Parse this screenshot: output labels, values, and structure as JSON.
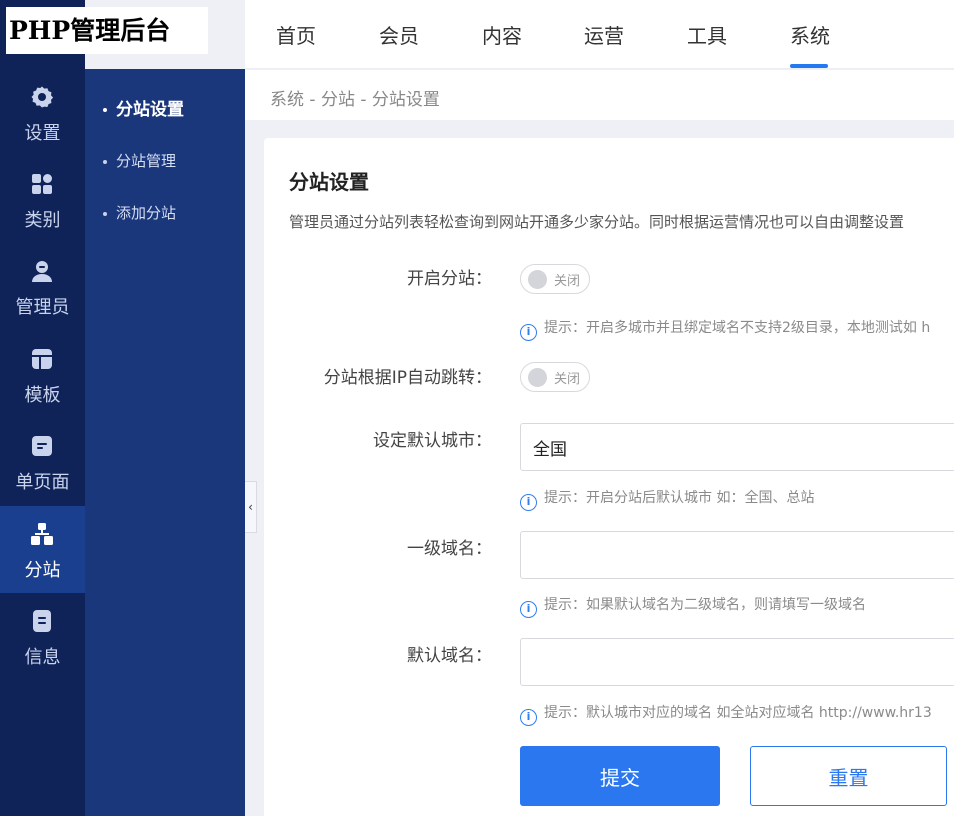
{
  "app": {
    "logo_text": "PHP管理后台"
  },
  "rail": {
    "items": [
      {
        "label": "设置",
        "icon": "gear-icon"
      },
      {
        "label": "类别",
        "icon": "grid-icon"
      },
      {
        "label": "管理员",
        "icon": "user-icon"
      },
      {
        "label": "模板",
        "icon": "template-icon"
      },
      {
        "label": "单页面",
        "icon": "page-icon"
      },
      {
        "label": "分站",
        "icon": "sitemap-icon",
        "active": true
      },
      {
        "label": "信息",
        "icon": "document-icon"
      }
    ]
  },
  "subnav": {
    "items": [
      {
        "label": "分站设置",
        "active": true
      },
      {
        "label": "分站管理"
      },
      {
        "label": "添加分站"
      }
    ]
  },
  "topnav": {
    "tabs": [
      {
        "label": "首页"
      },
      {
        "label": "会员"
      },
      {
        "label": "内容"
      },
      {
        "label": "运营"
      },
      {
        "label": "工具"
      },
      {
        "label": "系统",
        "active": true
      }
    ]
  },
  "breadcrumb": "系统 - 分站 - 分站设置",
  "card": {
    "title": "分站设置",
    "description": "管理员通过分站列表轻松查询到网站开通多少家分站。同时根据运营情况也可以自由调整设置"
  },
  "form": {
    "enable_substation": {
      "label": "开启分站：",
      "toggle_text": "关闭",
      "hint": "提示：开启多城市并且绑定域名不支持2级目录，本地测试如 h"
    },
    "ip_redirect": {
      "label": "分站根据IP自动跳转：",
      "toggle_text": "关闭"
    },
    "default_city": {
      "label": "设定默认城市：",
      "value": "全国",
      "hint": "提示：开启分站后默认城市 如：全国、总站"
    },
    "top_domain": {
      "label": "一级域名：",
      "value": "",
      "hint": "提示：如果默认域名为二级域名，则请填写一级域名"
    },
    "default_domain": {
      "label": "默认域名：",
      "value": "",
      "hint": "提示：默认城市对应的域名 如全站对应域名 http://www.hr13"
    },
    "submit_label": "提交",
    "reset_label": "重置"
  },
  "colors": {
    "accent": "#2a77f0",
    "rail_bg": "#0f2358",
    "subnav_bg": "#1a377c"
  }
}
